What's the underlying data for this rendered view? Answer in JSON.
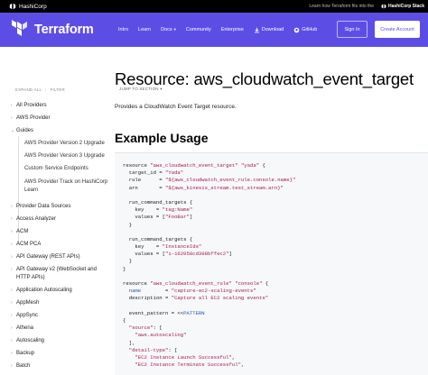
{
  "topbar": {
    "brand": "HashiCorp",
    "learn_link": "Learn how Terraform fits into the",
    "stack_link": "HashiCorp Stack"
  },
  "nav": {
    "brand": "Terraform",
    "links": [
      "Intro",
      "Learn",
      "Docs",
      "Community",
      "Enterprise",
      "Download",
      "GitHub"
    ],
    "signin": "Sign In",
    "create_account": "Create Account",
    "accent": "#5c4ee5"
  },
  "sidebar": {
    "expand_all": "EXPAND ALL",
    "filter": "FILTER",
    "items": [
      "All Providers",
      "AWS Provider",
      "Guides",
      "AWS Provider Version 2 Upgrade",
      "AWS Provider Version 3 Upgrade",
      "Custom Service Endpoints",
      "AWS Provider Track on HashiCorp Learn",
      "Provider Data Sources",
      "Access Analyzer",
      "ACM",
      "ACM PCA",
      "API Gateway (REST APIs)",
      "API Gateway v2 (WebSocket and HTTP APIs)",
      "Application Autoscaling",
      "AppMesh",
      "AppSync",
      "Athena",
      "Autoscaling",
      "Backup",
      "Batch"
    ]
  },
  "main": {
    "title": "Resource: aws_cloudwatch_event_target",
    "jump": "JUMP TO SECTION",
    "description": "Provides a CloudWatch Event Target resource.",
    "section": "Example Usage"
  },
  "code": [
    {
      "p": [
        "resource ",
        {
          "s": "\"aws_cloudwatch_event_target\""
        },
        " ",
        {
          "s": "\"yada\""
        },
        " {"
      ]
    },
    {
      "p": [
        "  target_id = ",
        {
          "s": "\"Yada\""
        }
      ]
    },
    {
      "p": [
        "  rule      = ",
        {
          "s": "\"${aws_cloudwatch_event_rule.console.name}\""
        }
      ]
    },
    {
      "p": [
        "  arn       = ",
        {
          "s": "\"${aws_kinesis_stream.test_stream.arn}\""
        }
      ]
    },
    {
      "p": [
        ""
      ]
    },
    {
      "p": [
        "  run_command_targets {"
      ]
    },
    {
      "p": [
        "    key    = ",
        {
          "s": "\"tag:Name\""
        }
      ]
    },
    {
      "p": [
        "    values = [",
        {
          "s": "\"FooBar\""
        },
        "]"
      ]
    },
    {
      "p": [
        "  }"
      ]
    },
    {
      "p": [
        ""
      ]
    },
    {
      "p": [
        "  run_command_targets {"
      ]
    },
    {
      "p": [
        "    key    = ",
        {
          "s": "\"InstanceIds\""
        }
      ]
    },
    {
      "p": [
        "    values = [",
        {
          "s": "\"i-162058cd308bffec2\""
        },
        "]"
      ]
    },
    {
      "p": [
        "  }"
      ]
    },
    {
      "p": [
        "}"
      ]
    },
    {
      "p": [
        ""
      ]
    },
    {
      "p": [
        "resource ",
        {
          "s": "\"aws_cloudwatch_event_rule\""
        },
        " ",
        {
          "s": "\"console\""
        },
        " {"
      ]
    },
    {
      "p": [
        "  ",
        {
          "k": "name"
        },
        "        = ",
        {
          "s": "\"capture-ec2-scaling-events\""
        }
      ]
    },
    {
      "p": [
        "  description = ",
        {
          "s": "\"Capture all EC2 scaling events\""
        }
      ]
    },
    {
      "p": [
        ""
      ]
    },
    {
      "p": [
        "  event_pattern = <<",
        {
          "k": "PATTERN"
        }
      ]
    },
    {
      "p": [
        "{"
      ]
    },
    {
      "p": [
        "  ",
        {
          "s": "\"source\""
        },
        ": ["
      ]
    },
    {
      "p": [
        "    ",
        {
          "s": "\"aws.autoscaling\""
        }
      ]
    },
    {
      "p": [
        "  ],"
      ]
    },
    {
      "p": [
        "  ",
        {
          "s": "\"detail-type\""
        },
        ": ["
      ]
    },
    {
      "p": [
        "    ",
        {
          "s": "\"EC2 Instance Launch Successful\""
        },
        ","
      ]
    },
    {
      "p": [
        "    ",
        {
          "s": "\"EC2 Instance Terminate Successful\""
        },
        ","
      ]
    }
  ]
}
